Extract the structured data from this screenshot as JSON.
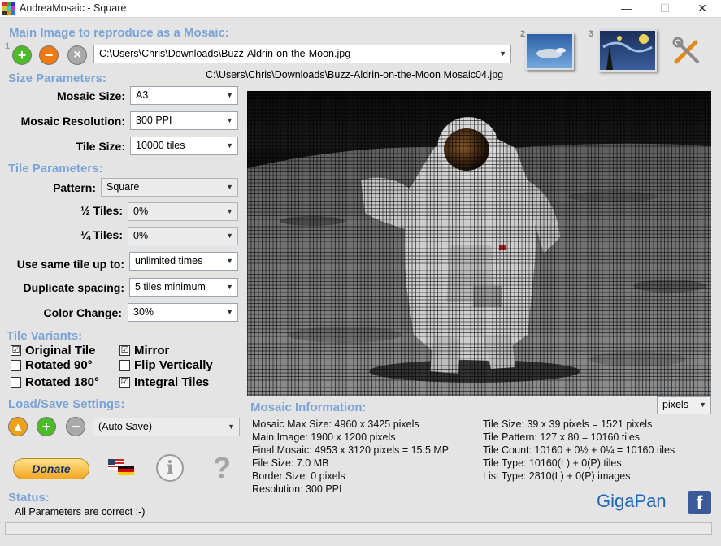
{
  "window": {
    "title": "AndreaMosaic - Square"
  },
  "main_image": {
    "heading": "Main Image to reproduce as a Mosaic:",
    "path": "C:\\Users\\Chris\\Downloads\\Buzz-Aldrin-on-the-Moon.jpg",
    "output_path": "C:\\Users\\Chris\\Downloads\\Buzz-Aldrin-on-the-Moon Mosaic04.jpg"
  },
  "size_params": {
    "heading": "Size Parameters:",
    "mosaic_size_label": "Mosaic Size:",
    "mosaic_size": "A3",
    "resolution_label": "Mosaic Resolution:",
    "resolution": "300 PPI",
    "tile_size_label": "Tile Size:",
    "tile_size": "10000 tiles"
  },
  "tile_params": {
    "heading": "Tile Parameters:",
    "pattern_label": "Pattern:",
    "pattern": "Square",
    "half_label": "½ Tiles:",
    "half": "0%",
    "quarter_label": "¼ Tiles:",
    "quarter": "0%",
    "same_tile_label": "Use same tile up to:",
    "same_tile": "unlimited times",
    "dup_label": "Duplicate spacing:",
    "dup": "5 tiles minimum",
    "color_label": "Color Change:",
    "color": "30%"
  },
  "variants": {
    "heading": "Tile Variants:",
    "items": [
      {
        "label": "Original Tile",
        "mark": "☑"
      },
      {
        "label": "Rotated 90°",
        "mark": ""
      },
      {
        "label": "Rotated 180°",
        "mark": ""
      },
      {
        "label": "Mirror",
        "mark": "☑"
      },
      {
        "label": "Flip Vertically",
        "mark": ""
      },
      {
        "label": "Integral Tiles",
        "mark": "☑"
      }
    ]
  },
  "load_save": {
    "heading": "Load/Save Settings:",
    "selected": "(Auto Save)"
  },
  "donate": {
    "label": "Donate"
  },
  "status": {
    "heading": "Status:",
    "text": "All Parameters are correct :-)"
  },
  "mosaic_info": {
    "heading": "Mosaic Information:",
    "units": "pixels",
    "left": [
      "Mosaic Max Size: 4960 x 3425 pixels",
      "Main Image: 1900 x 1200 pixels",
      "Final Mosaic: 4953 x 3120 pixels = 15.5 MP",
      "File Size: 7.0 MB",
      "Border Size: 0 pixels",
      "Resolution: 300 PPI"
    ],
    "right": [
      "Tile Size: 39 x 39 pixels = 1521 pixels",
      "Tile Pattern: 127 x 80 = 10160 tiles",
      "Tile Count: 10160 + 0½ + 0¼ = 10160 tiles",
      "Tile Type: 10160(L) + 0(P) tiles",
      "List Type: 2810(L) + 0(P) images"
    ]
  },
  "branding": {
    "gigapan": "GigaPan",
    "facebook": "f"
  },
  "badges": {
    "one": "1",
    "two": "2",
    "three": "3"
  },
  "icons": {
    "add": "+",
    "remove": "−",
    "clear": "×",
    "info": "i",
    "help": "?"
  }
}
